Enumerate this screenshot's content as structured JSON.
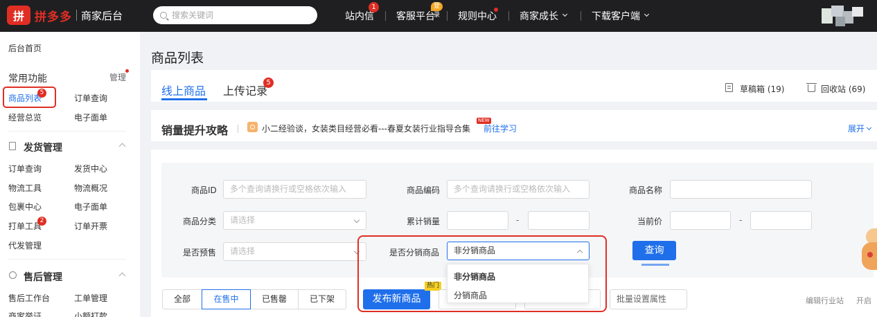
{
  "colors": {
    "brand": "#e02e24",
    "primary": "#1f6feb",
    "topbar": "#1f1f22",
    "annotation": "#e02e24"
  },
  "header": {
    "logo_mark": "拼",
    "logo_name": "拼多多",
    "logo_sub": "商家后台",
    "search_placeholder": "搜索关键词",
    "nav": {
      "inbox": "站内信",
      "inbox_badge": "1",
      "service": "客服平台",
      "service_tag": "登录",
      "rules": "规则中心",
      "growth": "商家成长",
      "download": "下载客户端"
    }
  },
  "sidebar": {
    "home": "后台首页",
    "common_title": "常用功能",
    "manage": "管理",
    "common_items": [
      "商品列表",
      "订单查询",
      "经营总览",
      "电子面单"
    ],
    "product_list_badge": "5",
    "shipping_title": "发货管理",
    "shipping_items": [
      "订单查询",
      "发货中心",
      "物流工具",
      "物流概况",
      "包裹中心",
      "电子面单",
      "打单工具",
      "订单开票",
      "代发管理"
    ],
    "print_tool_badge": "2",
    "aftersale_title": "售后管理",
    "aftersale_items": [
      "售后工作台",
      "工单管理",
      "商家举证",
      "小额打款"
    ]
  },
  "main": {
    "title": "商品列表",
    "tabs": {
      "online": "线上商品",
      "upload": "上传记录",
      "upload_badge": "5"
    },
    "drafts": "草稿箱 (19)",
    "recycle": "回收站 (69)",
    "tips": {
      "title": "销量提升攻略",
      "text": "小二经验谈，女装类目经营必看---春夏女装行业指导合集",
      "new_badge": "NEW",
      "link": "前往学习",
      "expand": "展开"
    },
    "filters": {
      "id_label": "商品ID",
      "id_placeholder": "多个查询请换行或空格依次输入",
      "code_label": "商品编码",
      "code_placeholder": "多个查询请换行或空格依次输入",
      "name_label": "商品名称",
      "category_label": "商品分类",
      "category_placeholder": "请选择",
      "sales_label": "累计销量",
      "price_label": "当前价",
      "presale_label": "是否预售",
      "presale_placeholder": "请选择",
      "distrib_label": "是否分销商品",
      "distrib_value": "非分销商品",
      "distrib_options": [
        "非分销商品",
        "分销商品"
      ],
      "range_sep": "-",
      "query": "查询"
    },
    "status_tabs": [
      "全部",
      "在售中",
      "已售罄",
      "已下架"
    ],
    "publish": "发布新商品",
    "hot_tag": "热门",
    "batch_edit": "批量设置属性",
    "industry": "编辑行业站",
    "industry_peek": "开启"
  }
}
